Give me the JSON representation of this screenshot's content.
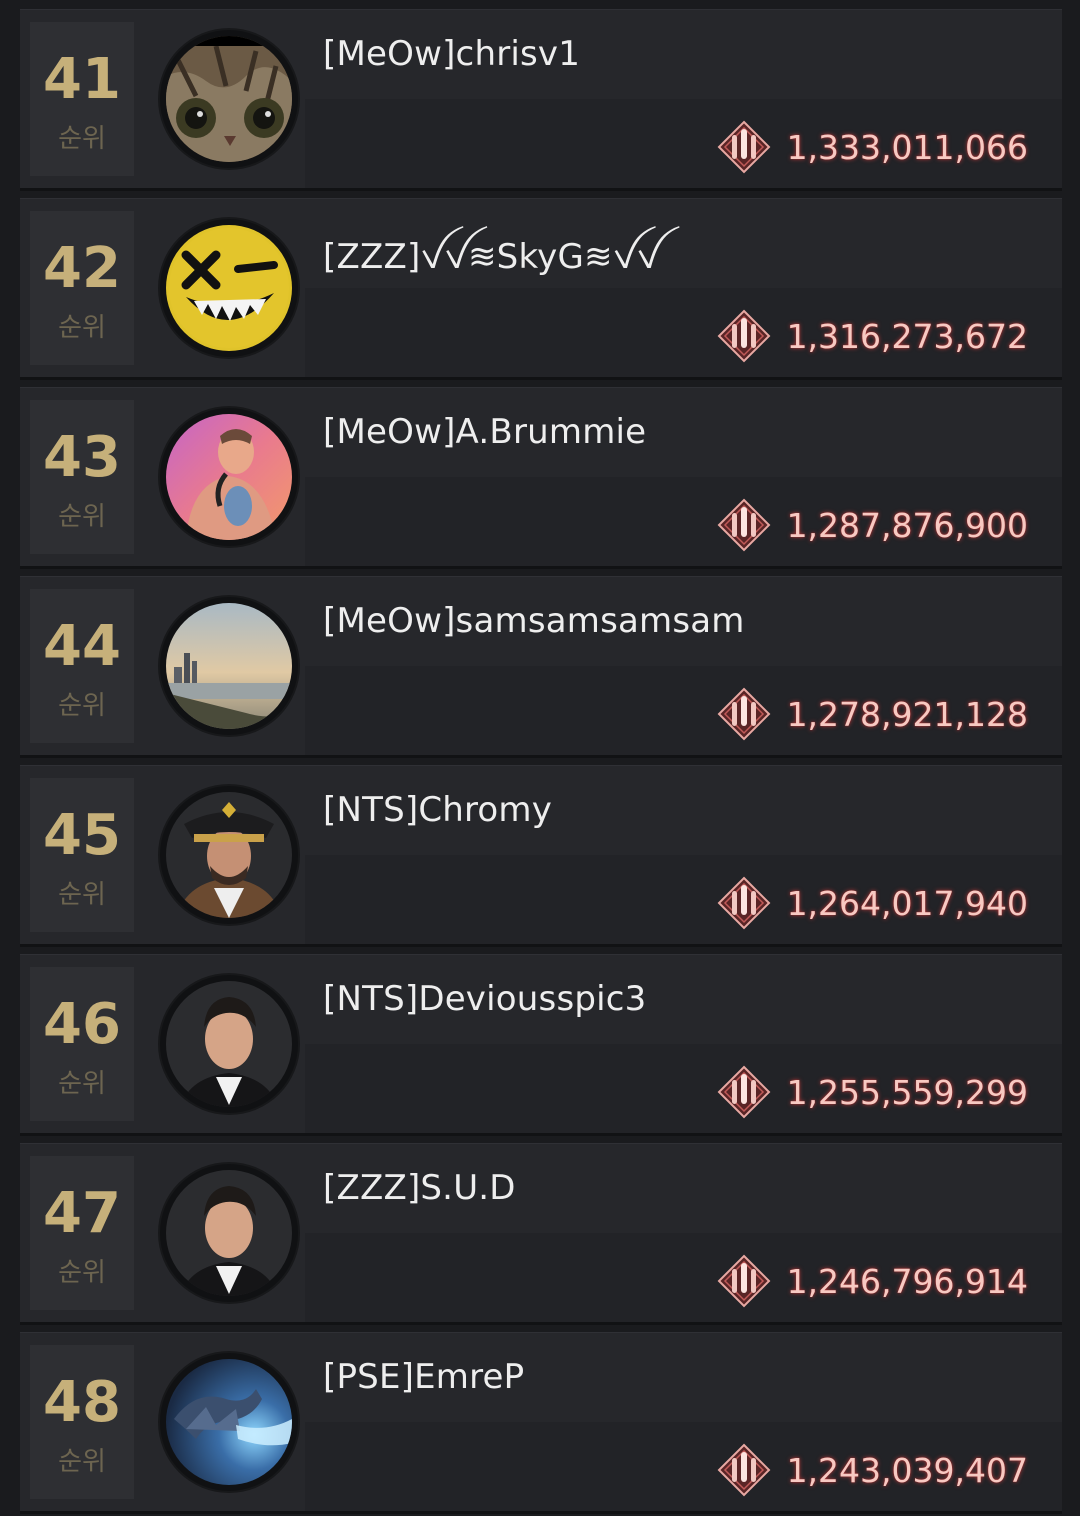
{
  "rank_label": "순위",
  "accent_colors": {
    "rank": "#c6b07a",
    "score": "#f7c9c2",
    "score_glow": "#d63c3c"
  },
  "entries": [
    {
      "rank": "41",
      "name": "[MeOw]chrisv1",
      "score": "1,333,011,066",
      "avatar": "cat-face-avatar"
    },
    {
      "rank": "42",
      "name": "[ZZZ]ꪜꪜ≋SkyG≋ꪜꪜ",
      "score": "1,316,273,672",
      "avatar": "yellow-smiley-avatar"
    },
    {
      "rank": "43",
      "name": "[MeOw]A.Brummie",
      "score": "1,287,876,900",
      "avatar": "portrait-pink-avatar"
    },
    {
      "rank": "44",
      "name": "[MeOw]samsamsamsam",
      "score": "1,278,921,128",
      "avatar": "harbor-sunset-avatar"
    },
    {
      "rank": "45",
      "name": "[NTS]Chromy",
      "score": "1,264,017,940",
      "avatar": "captain-portrait-avatar"
    },
    {
      "rank": "46",
      "name": "[NTS]Deviousspic3",
      "score": "1,255,559,299",
      "avatar": "suit-portrait-avatar"
    },
    {
      "rank": "47",
      "name": "[ZZZ]S.U.D",
      "score": "1,246,796,914",
      "avatar": "suit-portrait-avatar"
    },
    {
      "rank": "48",
      "name": "[PSE]EmreP",
      "score": "1,243,039,407",
      "avatar": "dragon-avatar"
    }
  ],
  "score_icon": "missile-emblem-icon"
}
